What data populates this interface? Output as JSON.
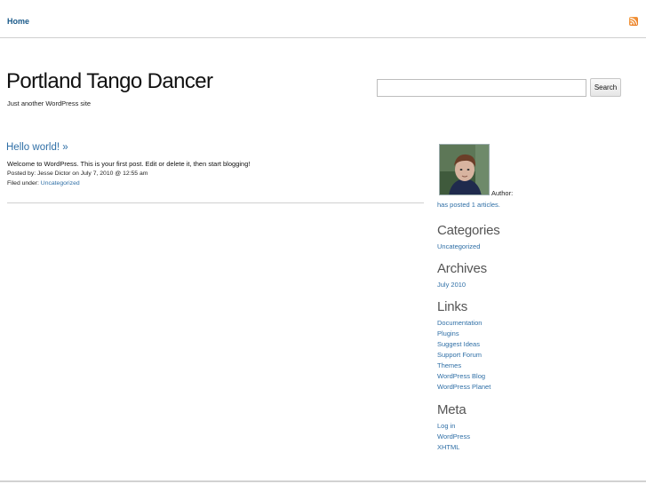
{
  "nav": {
    "home_label": "Home",
    "rss_icon": "rss-icon",
    "rss_color": "#ee8a2a"
  },
  "header": {
    "title": "Portland Tango Dancer",
    "tagline": "Just another WordPress site"
  },
  "search": {
    "placeholder": "",
    "button_label": "Search"
  },
  "post": {
    "title": "Hello world! »",
    "body": "Welcome to WordPress. This is your first post. Edit or delete it, then start blogging!",
    "meta": "Posted by: Jesse Dictor on July 7, 2010 @ 12:55 am",
    "filed_label": "Filed under:",
    "category": "Uncategorized"
  },
  "sidebar": {
    "author_label": "Author:",
    "author_posts": "has posted 1 articles.",
    "categories": {
      "title": "Categories",
      "items": [
        "Uncategorized"
      ]
    },
    "archives": {
      "title": "Archives",
      "items": [
        "July 2010"
      ]
    },
    "links": {
      "title": "Links",
      "items": [
        "Documentation",
        "Plugins",
        "Suggest Ideas",
        "Support Forum",
        "Themes",
        "WordPress Blog",
        "WordPress Planet"
      ]
    },
    "meta": {
      "title": "Meta",
      "items": [
        "Log in",
        "WordPress",
        "XHTML"
      ]
    }
  },
  "colors": {
    "link": "#2f6fa6",
    "nav_link": "#1a5a8a",
    "heading": "#555555",
    "divider": "#cfcfcf"
  }
}
